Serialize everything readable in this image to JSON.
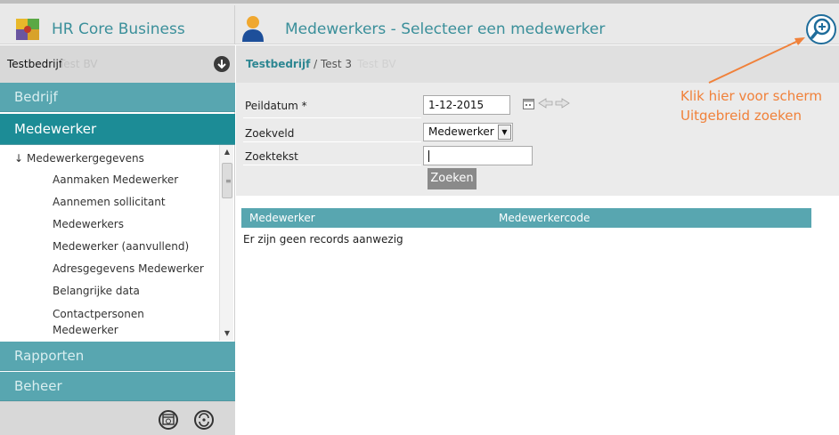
{
  "header": {
    "app_title": "HR Core Business",
    "page_title": "Medewerkers - Selecteer een medewerker",
    "accent_color": "#3a8f9a"
  },
  "sidebar": {
    "company": "Testbedrijf",
    "company_ghost": "Test BV",
    "sections": {
      "bedrijf": "Bedrijf",
      "medewerker": "Medewerker",
      "rapporten": "Rapporten",
      "beheer": "Beheer"
    },
    "tree": {
      "header": "Medewerkergegevens",
      "items": [
        "Aanmaken Medewerker",
        "Aannemen sollicitant",
        "Medewerkers",
        "Medewerker (aanvullend)",
        "Adresgegevens Medewerker",
        "Belangrijke data",
        "Contactpersonen",
        "Medewerker"
      ]
    },
    "footer_icons": [
      "calendar-clock-icon",
      "refresh-people-icon"
    ]
  },
  "breadcrumb": {
    "company": "Testbedrijf",
    "separator": " / ",
    "page": "Test 3",
    "ghost": "Test BV"
  },
  "search": {
    "peildatum_label": "Peildatum *",
    "peildatum_value": "1-12-2015",
    "zoekveld_label": "Zoekveld",
    "zoekveld_value": "Medewerker",
    "zoektekst_label": "Zoektekst",
    "zoektekst_value": "",
    "zoeken_label": "Zoeken"
  },
  "annotation": {
    "line1": "Klik hier voor scherm",
    "line2": "Uitgebreid zoeken",
    "color": "#f0813a"
  },
  "results": {
    "columns": [
      "Medewerker",
      "Medewerkercode"
    ],
    "empty_message": "Er zijn geen records aanwezig"
  }
}
